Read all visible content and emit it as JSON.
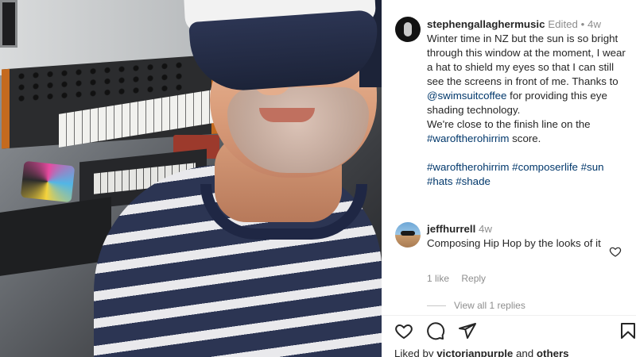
{
  "post": {
    "username": "stephengallaghermusic",
    "edited": "Edited",
    "separator": "•",
    "age": "4w",
    "caption_lines": [
      {
        "parts": [
          {
            "t": "Winter time in NZ but the sun is so bright through this window at the moment, I wear a hat to shield my eyes so that I can still see the screens in front of me. Thanks to ",
            "link": false
          },
          {
            "t": "@swimsuitcoffee",
            "link": true
          },
          {
            "t": " for providing this eye shading technology.",
            "link": false
          }
        ]
      },
      {
        "parts": [
          {
            "t": "We're close to the finish line on the ",
            "link": false
          },
          {
            "t": "#waroftherohirrim",
            "link": true
          },
          {
            "t": " score.",
            "link": false
          }
        ]
      }
    ],
    "hashtags": [
      "#waroftherohirrim",
      "#composerlife",
      "#sun",
      "#hats",
      "#shade"
    ]
  },
  "comment": {
    "username": "jeffhurrell",
    "age": "4w",
    "text": "Composing Hip Hop by the looks of it",
    "likes": "1 like",
    "reply": "Reply",
    "view_replies": "View all 1 replies"
  },
  "actions": {
    "icons": [
      "heart-icon",
      "comment-icon",
      "share-icon",
      "bookmark-icon"
    ]
  },
  "liked_by": {
    "prefix": "Liked by",
    "user": "victorianpurple",
    "connector": "and",
    "others": "others"
  },
  "colors": {
    "link": "#00376b",
    "meta": "#8e8e8e",
    "text": "#262626"
  }
}
